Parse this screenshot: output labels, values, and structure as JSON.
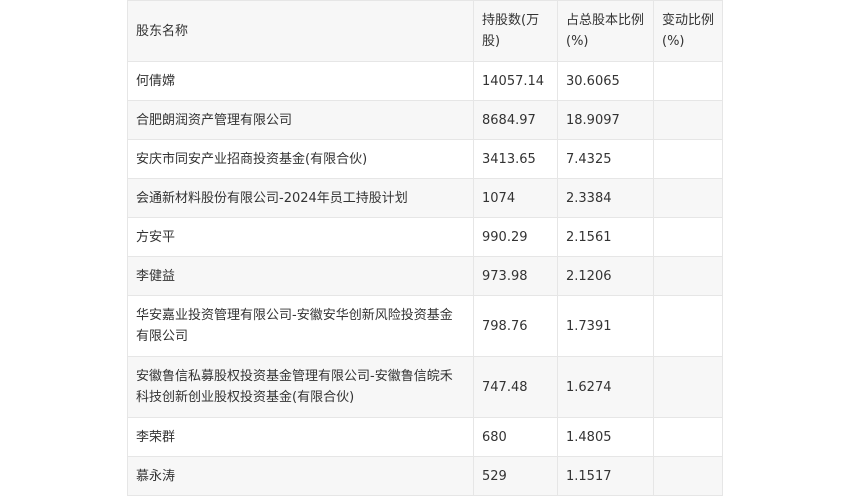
{
  "table": {
    "headers": [
      "股东名称",
      "持股数(万股)",
      "占总股本比例(%)",
      "变动比例(%)"
    ],
    "rows": [
      {
        "name": "何倩嫦",
        "shares": "14057.14",
        "ratio": "30.6065",
        "change": ""
      },
      {
        "name": "合肥朗润资产管理有限公司",
        "shares": "8684.97",
        "ratio": "18.9097",
        "change": ""
      },
      {
        "name": "安庆市同安产业招商投资基金(有限合伙)",
        "shares": "3413.65",
        "ratio": "7.4325",
        "change": ""
      },
      {
        "name": "会通新材料股份有限公司-2024年员工持股计划",
        "shares": "1074",
        "ratio": "2.3384",
        "change": ""
      },
      {
        "name": "方安平",
        "shares": "990.29",
        "ratio": "2.1561",
        "change": ""
      },
      {
        "name": "李健益",
        "shares": "973.98",
        "ratio": "2.1206",
        "change": ""
      },
      {
        "name": "华安嘉业投资管理有限公司-安徽安华创新风险投资基金有限公司",
        "shares": "798.76",
        "ratio": "1.7391",
        "change": ""
      },
      {
        "name": "安徽鲁信私募股权投资基金管理有限公司-安徽鲁信皖禾科技创新创业股权投资基金(有限合伙)",
        "shares": "747.48",
        "ratio": "1.6274",
        "change": ""
      },
      {
        "name": "李荣群",
        "shares": "680",
        "ratio": "1.4805",
        "change": ""
      },
      {
        "name": "慕永涛",
        "shares": "529",
        "ratio": "1.1517",
        "change": ""
      }
    ]
  }
}
